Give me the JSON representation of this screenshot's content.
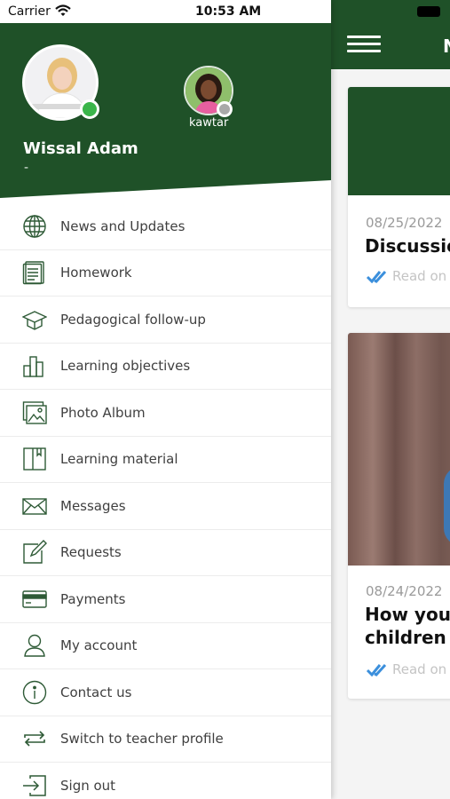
{
  "status_bar": {
    "carrier": "Carrier",
    "time": "10:53 AM"
  },
  "drawer": {
    "user_name": "Wissal Adam",
    "user_subtitle": "-",
    "child_name": "kawtar",
    "menu": [
      {
        "label": "News and Updates",
        "icon": "globe-icon"
      },
      {
        "label": "Homework",
        "icon": "document-icon"
      },
      {
        "label": "Pedagogical follow-up",
        "icon": "graduation-cap-icon"
      },
      {
        "label": "Learning objectives",
        "icon": "bar-chart-icon"
      },
      {
        "label": "Photo Album",
        "icon": "photo-album-icon"
      },
      {
        "label": "Learning material",
        "icon": "book-icon"
      },
      {
        "label": "Messages",
        "icon": "envelope-icon"
      },
      {
        "label": "Requests",
        "icon": "edit-icon"
      },
      {
        "label": "Payments",
        "icon": "credit-card-icon"
      },
      {
        "label": "My account",
        "icon": "user-icon"
      },
      {
        "label": "Contact us",
        "icon": "info-icon"
      },
      {
        "label": "Switch to teacher profile",
        "icon": "switch-icon"
      },
      {
        "label": "Sign out",
        "icon": "sign-out-icon"
      }
    ]
  },
  "main": {
    "title_peek": "N",
    "posts": [
      {
        "date": "08/25/2022",
        "title": "Discussio",
        "read_label": "Read on"
      },
      {
        "date": "08/24/2022",
        "title_line1": "How you",
        "title_line2": "children",
        "read_label": "Read on"
      }
    ]
  },
  "colors": {
    "brand_green": "#1f5128",
    "online": "#3ab54a",
    "offline": "#a9a9a9",
    "read_check": "#3b8fdc"
  }
}
